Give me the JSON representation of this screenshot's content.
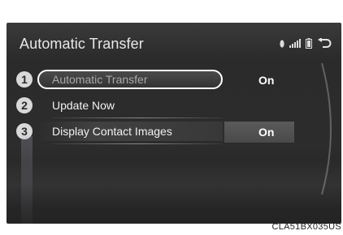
{
  "screen": {
    "title": "Automatic Transfer",
    "status_icons": [
      "bluetooth-icon",
      "signal-bars-icon",
      "battery-icon",
      "back-arrow-icon"
    ]
  },
  "menu": {
    "items": [
      {
        "number": "1",
        "label": "Automatic Transfer",
        "value": "On"
      },
      {
        "number": "2",
        "label": "Update Now",
        "value": ""
      },
      {
        "number": "3",
        "label": "Display Contact Images",
        "value": "On"
      }
    ]
  },
  "caption": "CLA51BX035US",
  "colors": {
    "screen_bg": "#2b2b2b",
    "text": "#f2f2f2",
    "selected_label": "#a9a9a9",
    "value_bg": "#4a4a4a"
  }
}
